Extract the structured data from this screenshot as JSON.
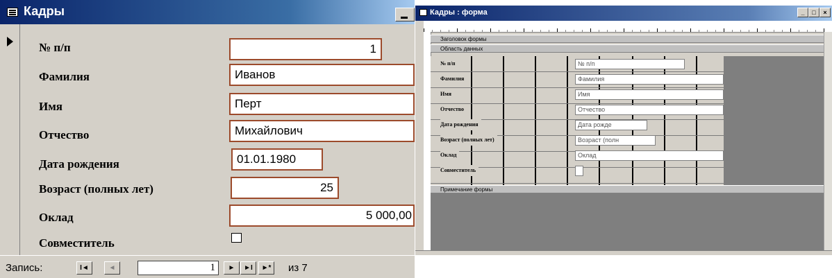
{
  "form_window": {
    "title": "Кадры",
    "fields": [
      {
        "label": "№ п/п",
        "value": "1"
      },
      {
        "label": "Фамилия",
        "value": "Иванов"
      },
      {
        "label": "Имя",
        "value": "Перт"
      },
      {
        "label": "Отчество",
        "value": "Михайлович"
      },
      {
        "label": "Дата рождения",
        "value": "01.01.1980"
      },
      {
        "label": "Возраст (полных лет)",
        "value": "25"
      },
      {
        "label": "Оклад",
        "value": "5 000,00"
      },
      {
        "label": "Совместитель",
        "checked": false
      }
    ],
    "navigation": {
      "record_label": "Запись:",
      "first": "I◄",
      "prev": "◄",
      "current": "1",
      "next": "►",
      "last": "►I",
      "new": "►*",
      "of_text": "из 7"
    }
  },
  "design_window": {
    "title": "Кадры : форма",
    "buttons": {
      "minimize": "_",
      "restore": "□",
      "close": "×"
    },
    "sections": {
      "header": "Заголовок формы",
      "detail": "Область данных",
      "footer": "Примечание формы"
    },
    "fields": [
      {
        "label": "№ п/п",
        "control": "№ п/п"
      },
      {
        "label": "Фамилия",
        "control": "Фамилия"
      },
      {
        "label": "Имя",
        "control": "Имя"
      },
      {
        "label": "Отчество",
        "control": "Отчество"
      },
      {
        "label": "Дата рождения",
        "control": "Дата рожде"
      },
      {
        "label": "Возраст (полных лет)",
        "control": "Возраст (полн"
      },
      {
        "label": "Оклад",
        "control": "Оклад"
      },
      {
        "label": "Совместитель",
        "control": ""
      }
    ]
  }
}
